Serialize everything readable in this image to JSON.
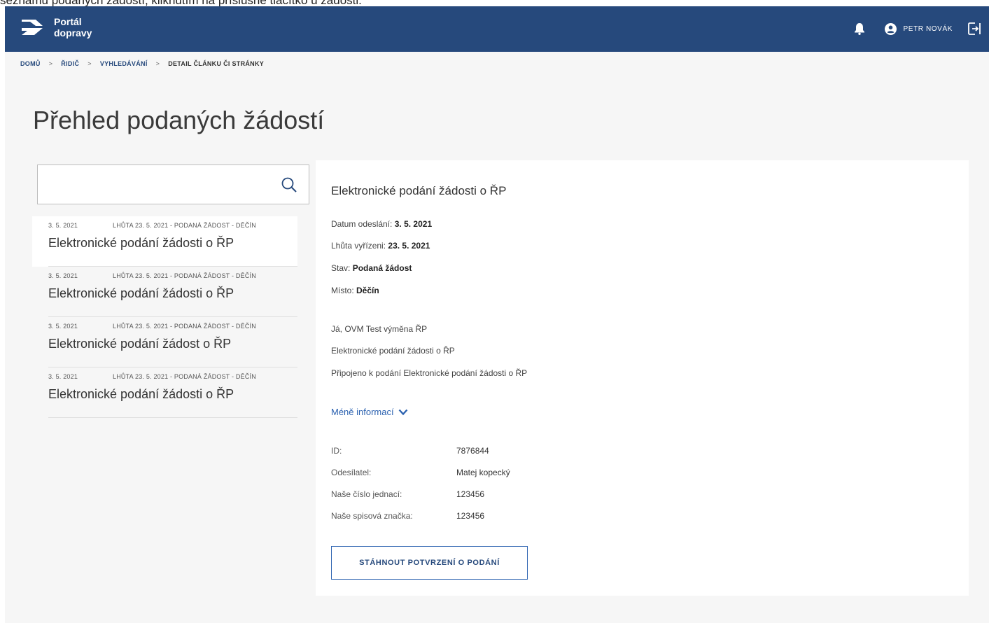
{
  "caption": "seznamu podaných žádostí, kliknutím na příslušné tlačítko u žádosti.",
  "header": {
    "logo_line1": "Portál",
    "logo_line2": "dopravy",
    "user_name": "PETR NOVÁK",
    "bg_color": "#26497c"
  },
  "breadcrumb": {
    "items": [
      "DOMŮ",
      "ŘIDIČ",
      "VYHLEDÁVÁNÍ"
    ],
    "current": "DETAIL ČLÁNKU ČI STRÁNKY",
    "separator": ">"
  },
  "page_title": "Přehled podaných žádostí",
  "search": {
    "value": "",
    "placeholder": ""
  },
  "requests": [
    {
      "date": "3. 5. 2021",
      "meta": "LHŮTA 23. 5. 2021 - PODANÁ ŽÁDOST - DĚČÍN",
      "title": "Elektronické podání žádosti o ŘP"
    },
    {
      "date": "3. 5. 2021",
      "meta": "LHŮTA 23. 5. 2021 - PODANÁ ŽÁDOST - DĚČÍN",
      "title": "Elektronické podání žádosti o ŘP"
    },
    {
      "date": "3. 5. 2021",
      "meta": "LHŮTA 23. 5. 2021 - PODANÁ ŽÁDOST - DĚČÍN",
      "title": "Elektronické podání žádost o ŘP"
    },
    {
      "date": "3. 5. 2021",
      "meta": "LHŮTA 23. 5. 2021 - PODANÁ ŽÁDOST - DĚČÍN",
      "title": "Elektronické podání žádosti o ŘP"
    }
  ],
  "detail": {
    "title": "Elektronické podání žádosti o ŘP",
    "sent_label": "Datum odeslání:",
    "sent_value": "3. 5. 2021",
    "deadline_label": "Lhůta vyřízeni:",
    "deadline_value": "23. 5. 2021",
    "status_label": "Stav:",
    "status_value": "Podaná žádost",
    "place_label": "Místo:",
    "place_value": "Děčín",
    "line1": "Já, OVM Test výměna ŘP",
    "line2": "Elektronické podání žádosti o ŘP",
    "line3": "Připojeno k podání Elektronické podání žádosti o ŘP",
    "less_info": "Méně informací",
    "meta": [
      {
        "label": "ID:",
        "value": "7876844"
      },
      {
        "label": "Odesílatel:",
        "value": "Matej kopecký"
      },
      {
        "label": "Naše číslo jednací:",
        "value": "123456"
      },
      {
        "label": "Naše spisová značka:",
        "value": "123456"
      }
    ],
    "download_label": "STÁHNOUT POTVRZENÍ O PODÁNÍ"
  }
}
